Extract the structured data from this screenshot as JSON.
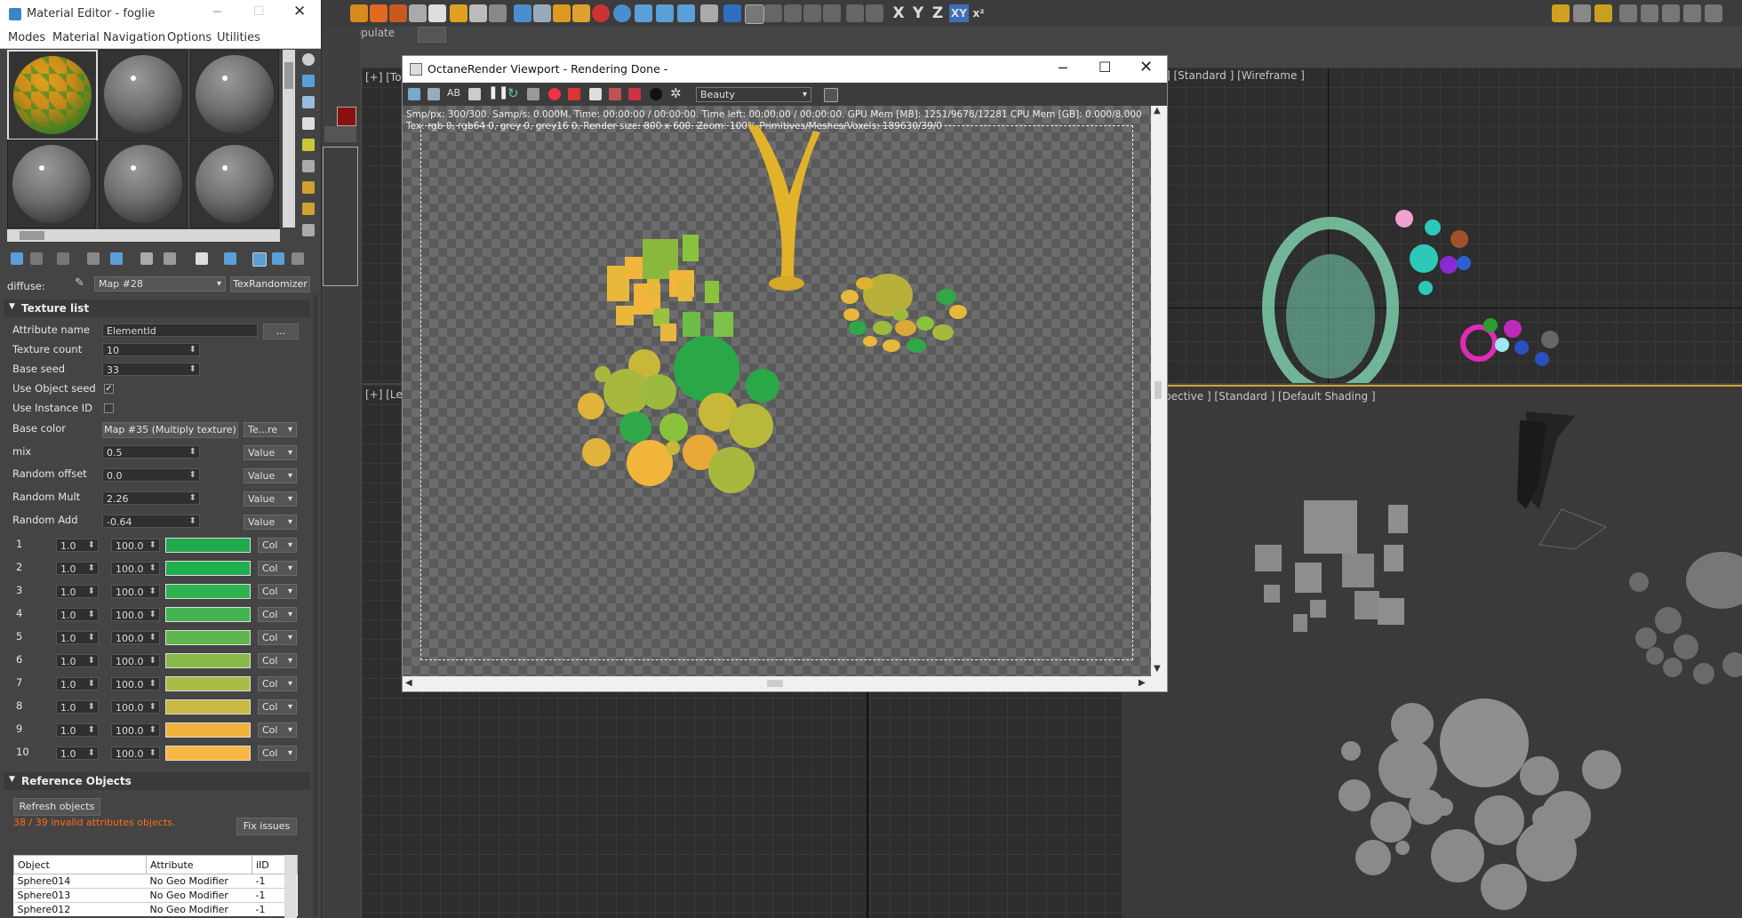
{
  "max": {
    "populate_label": "Populate",
    "axes": [
      "X",
      "Y",
      "Z",
      "XY"
    ],
    "axis_helper": "x²"
  },
  "viewports": {
    "top_left": "[+] [To",
    "left": "[+] [Le",
    "right_top": "] [Standard ] [Wireframe ]",
    "perspective": "pective ] [Standard ] [Default Shading ]"
  },
  "material_editor": {
    "title": "Material Editor - foglie",
    "menu": [
      "Modes",
      "Material",
      "Navigation",
      "Options",
      "Utilities"
    ],
    "diffuse_label": "diffuse:",
    "map_name": "Map #28",
    "tex_randomizer": "TexRandomizer",
    "texture_list": {
      "header": "Texture list",
      "attribute_name_label": "Attribute name",
      "attribute_name_value": "ElementId",
      "dots_button": "...",
      "texture_count_label": "Texture count",
      "texture_count": "10",
      "base_seed_label": "Base seed",
      "base_seed": "33",
      "use_object_seed_label": "Use Object seed",
      "use_object_seed_check": "✓",
      "use_instance_id_label": "Use Instance ID",
      "base_color_label": "Base color",
      "base_color_map": "Map #35 (Multiply texture)",
      "base_color_mode": "Te...re",
      "mix_label": "mix",
      "mix": "0.5",
      "random_offset_label": "Random offset",
      "random_offset": "0.0",
      "random_mult_label": "Random Mult",
      "random_mult": "2.26",
      "random_add_label": "Random Add",
      "random_add": "-0.64",
      "value_mode": "Value",
      "rows": [
        {
          "n": "1",
          "a": "1.0",
          "b": "100.0",
          "color": "#1fa84c",
          "mode": "Col"
        },
        {
          "n": "2",
          "a": "1.0",
          "b": "100.0",
          "color": "#1fae4d",
          "mode": "Col"
        },
        {
          "n": "3",
          "a": "1.0",
          "b": "100.0",
          "color": "#2fb24f",
          "mode": "Col"
        },
        {
          "n": "4",
          "a": "1.0",
          "b": "100.0",
          "color": "#45b450",
          "mode": "Col"
        },
        {
          "n": "5",
          "a": "1.0",
          "b": "100.0",
          "color": "#5db54d",
          "mode": "Col"
        },
        {
          "n": "6",
          "a": "1.0",
          "b": "100.0",
          "color": "#8ab947",
          "mode": "Col"
        },
        {
          "n": "7",
          "a": "1.0",
          "b": "100.0",
          "color": "#a8bd46",
          "mode": "Col"
        },
        {
          "n": "8",
          "a": "1.0",
          "b": "100.0",
          "color": "#c9b844",
          "mode": "Col"
        },
        {
          "n": "9",
          "a": "1.0",
          "b": "100.0",
          "color": "#efb33d",
          "mode": "Col"
        },
        {
          "n": "10",
          "a": "1.0",
          "b": "100.0",
          "color": "#f7b843",
          "mode": "Col"
        }
      ]
    },
    "reference_objects": {
      "header": "Reference Objects",
      "refresh_button": "Refresh objects",
      "warning": "38 / 39 invalid attributes objects.",
      "fix_button": "Fix issues",
      "columns": [
        "Object",
        "Attribute",
        "iID"
      ],
      "rows": [
        {
          "object": "Sphere014",
          "attribute": "No Geo Modifier",
          "iid": "-1"
        },
        {
          "object": "Sphere013",
          "attribute": "No Geo Modifier",
          "iid": "-1"
        },
        {
          "object": "Sphere012",
          "attribute": "No Geo Modifier",
          "iid": "-1"
        }
      ]
    }
  },
  "octane": {
    "title": "OctaneRender Viewport - Rendering Done -",
    "ab_label": "AB",
    "channel": "Beauty",
    "stats_line1": "Smp/px: 300/300.   Samp/s: 0.000M.   Time: 00:00:00 / 00:00:00.   Time left: 00:00:00 / 00:00:00.   GPU Mem [MB]: 1251/9678/12281   CPU Mem [GB]: 0.000/8.000",
    "stats_line2": "Tex: rgb 0, rgb64 0, grey 0, grey16 0.   Render size: 800 x 600.   Zoom: 100%   Primitives/Meshes/Voxels: 189630/39/0"
  }
}
